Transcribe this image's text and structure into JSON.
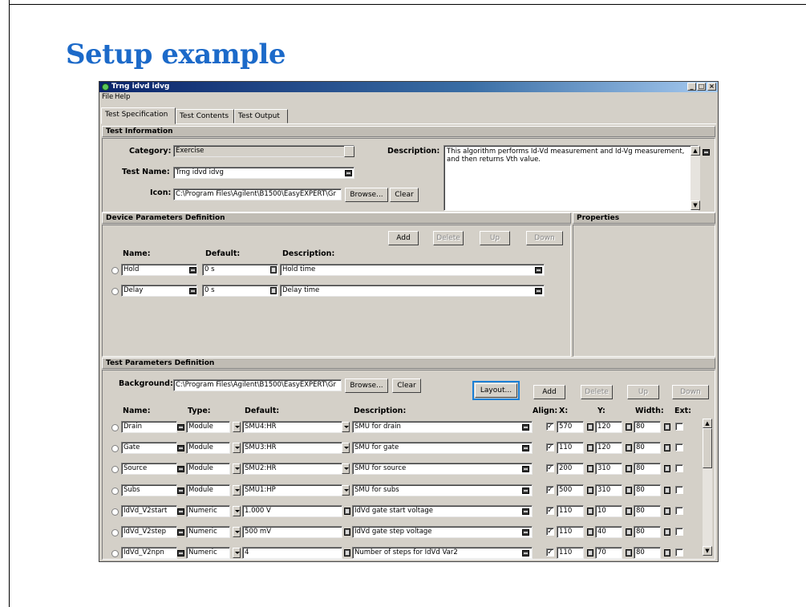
{
  "slide": {
    "title": "Setup example"
  },
  "window": {
    "title": "Trng idvd idvg",
    "controls": {
      "minimize": "_",
      "maximize": "□",
      "close": "×"
    }
  },
  "menu": {
    "items": [
      "File",
      "Help"
    ]
  },
  "tabs": [
    "Test Specification",
    "Test Contents",
    "Test Output"
  ],
  "test_information": {
    "header": "Test Information",
    "category_label": "Category:",
    "category_value": "Exercise",
    "test_name_label": "Test Name:",
    "test_name_value": "Trng idvd idvg",
    "icon_label": "Icon:",
    "icon_value": "C:\\Program Files\\Agilent\\B1500\\EasyEXPERT\\Gr",
    "browse_label": "Browse...",
    "clear_label": "Clear",
    "description_label": "Description:",
    "description_value": "This algorithm performs Id-Vd measurement and Id-Vg measurement, and then returns Vth value."
  },
  "device_parameters": {
    "header": "Device Parameters Definition",
    "properties_header": "Properties",
    "buttons": {
      "add": "Add",
      "delete": "Delete",
      "up": "Up",
      "down": "Down"
    },
    "columns": {
      "name": "Name:",
      "default": "Default:",
      "description": "Description:"
    },
    "rows": [
      {
        "name": "Hold",
        "default": "0 s",
        "description": "Hold time"
      },
      {
        "name": "Delay",
        "default": "0 s",
        "description": "Delay time"
      }
    ]
  },
  "test_parameters": {
    "header": "Test Parameters Definition",
    "background_label": "Background:",
    "background_value": "C:\\Program Files\\Agilent\\B1500\\EasyEXPERT\\Gr",
    "browse_label": "Browse...",
    "clear_label": "Clear",
    "layout_label": "Layout...",
    "buttons": {
      "add": "Add",
      "delete": "Delete",
      "up": "Up",
      "down": "Down"
    },
    "columns": {
      "name": "Name:",
      "type": "Type:",
      "default": "Default:",
      "description": "Description:",
      "align": "Align:",
      "x": "X:",
      "y": "Y:",
      "width": "Width:",
      "ext": "Ext:"
    },
    "rows": [
      {
        "name": "Drain",
        "type": "Module",
        "default": "SMU4:HR",
        "description": "SMU for drain",
        "x": "570",
        "y": "120",
        "width": "80"
      },
      {
        "name": "Gate",
        "type": "Module",
        "default": "SMU3:HR",
        "description": "SMU for gate",
        "x": "110",
        "y": "120",
        "width": "80"
      },
      {
        "name": "Source",
        "type": "Module",
        "default": "SMU2:HR",
        "description": "SMU for source",
        "x": "200",
        "y": "310",
        "width": "80"
      },
      {
        "name": "Subs",
        "type": "Module",
        "default": "SMU1:HP",
        "description": "SMU for subs",
        "x": "500",
        "y": "310",
        "width": "80"
      },
      {
        "name": "IdVd_V2start",
        "type": "Numeric",
        "default": "1.000 V",
        "description": "IdVd gate start voltage",
        "x": "110",
        "y": "10",
        "width": "80"
      },
      {
        "name": "IdVd_V2step",
        "type": "Numeric",
        "default": "500 mV",
        "description": "IdVd gate step voltage",
        "x": "110",
        "y": "40",
        "width": "80"
      },
      {
        "name": "IdVd_V2npn",
        "type": "Numeric",
        "default": "4",
        "description": "Number of steps for IdVd Var2",
        "x": "110",
        "y": "70",
        "width": "80"
      }
    ]
  },
  "colors": {
    "title_blue": "#1c6ac9",
    "window_face": "#d4d0c8",
    "focus_ring": "#1a7fd6"
  }
}
